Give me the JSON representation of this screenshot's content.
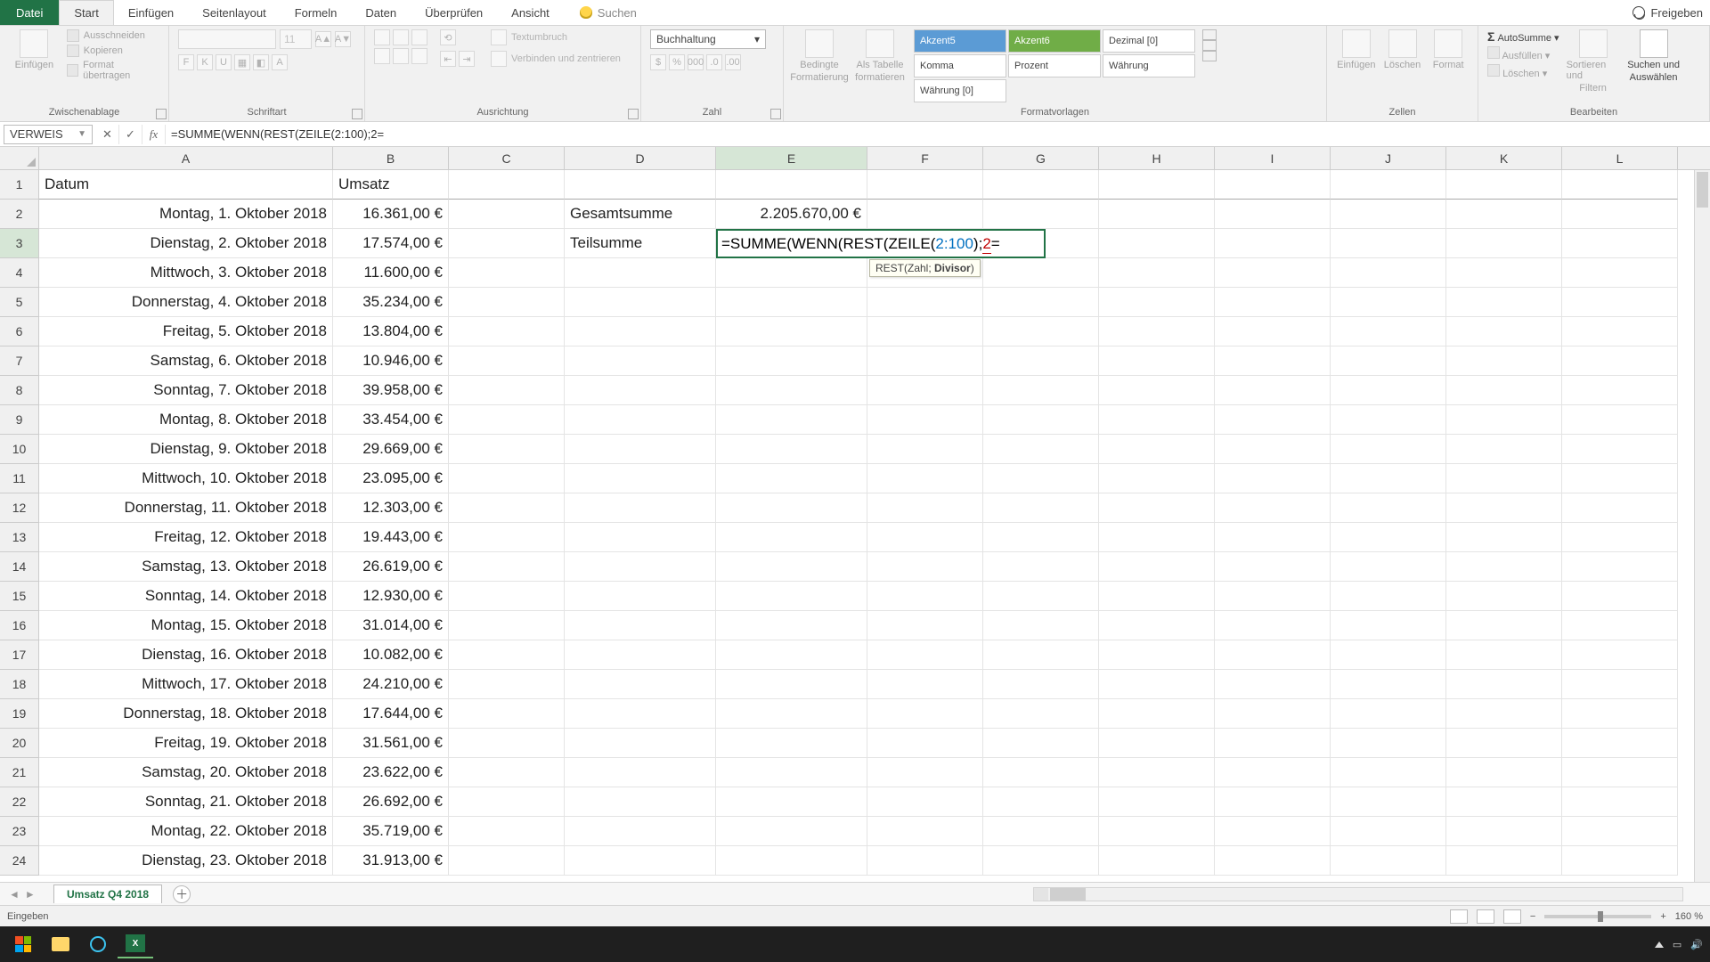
{
  "tabs": {
    "file": "Datei",
    "start": "Start",
    "insert": "Einfügen",
    "pagelayout": "Seitenlayout",
    "formulas": "Formeln",
    "data": "Daten",
    "review": "Überprüfen",
    "view": "Ansicht",
    "tellme": "Suchen",
    "share": "Freigeben"
  },
  "ribbon": {
    "clipboard": {
      "label": "Zwischenablage",
      "paste": "Einfügen",
      "cut": "Ausschneiden",
      "copy": "Kopieren",
      "painter": "Format übertragen"
    },
    "font": {
      "label": "Schriftart",
      "size": "11",
      "boldB": "F",
      "italicK": "K",
      "underlineU": "U"
    },
    "alignment": {
      "label": "Ausrichtung",
      "wrap": "Textumbruch",
      "merge": "Verbinden und zentrieren"
    },
    "number": {
      "label": "Zahl",
      "format": "Buchhaltung"
    },
    "styles": {
      "label": "Formatvorlagen",
      "cond": "Bedingte",
      "cond2": "Formatierung",
      "astable": "Als Tabelle",
      "astable2": "formatieren",
      "g": [
        "Akzent5",
        "Akzent6",
        "Dezimal [0]",
        "Komma",
        "Prozent",
        "Währung",
        "Währung [0]"
      ]
    },
    "cells": {
      "label": "Zellen",
      "insert": "Einfügen",
      "delete": "Löschen",
      "format": "Format"
    },
    "editing": {
      "label": "Bearbeiten",
      "sum": "AutoSumme",
      "fill": "Ausfüllen",
      "clear": "Löschen",
      "sort": "Sortieren und",
      "sort2": "Filtern",
      "find": "Suchen und",
      "find2": "Auswählen"
    }
  },
  "fbar": {
    "name": "VERWEIS",
    "formula": "=SUMME(WENN(REST(ZEILE(2:100);2="
  },
  "columns": [
    "A",
    "B",
    "C",
    "D",
    "E",
    "F",
    "G",
    "H",
    "I",
    "J",
    "K",
    "L"
  ],
  "headers": {
    "A": "Datum",
    "B": "Umsatz",
    "D2": "Gesamtsumme",
    "D3": "Teilsumme",
    "E2": "2.205.670,00 €"
  },
  "editing": {
    "pre": "=SUMME(WENN(",
    "rest": "REST(ZEILE(",
    "range": "2:100",
    "mid": ");",
    "div": "2",
    "post": "=",
    "tooltip_pre": "REST(Zahl; ",
    "tooltip_bold": "Divisor",
    "tooltip_post": ")"
  },
  "rows": [
    {
      "n": 1
    },
    {
      "n": 2,
      "A": "Montag, 1. Oktober 2018",
      "B": "16.361,00 €"
    },
    {
      "n": 3,
      "A": "Dienstag, 2. Oktober 2018",
      "B": "17.574,00 €"
    },
    {
      "n": 4,
      "A": "Mittwoch, 3. Oktober 2018",
      "B": "11.600,00 €"
    },
    {
      "n": 5,
      "A": "Donnerstag, 4. Oktober 2018",
      "B": "35.234,00 €"
    },
    {
      "n": 6,
      "A": "Freitag, 5. Oktober 2018",
      "B": "13.804,00 €"
    },
    {
      "n": 7,
      "A": "Samstag, 6. Oktober 2018",
      "B": "10.946,00 €"
    },
    {
      "n": 8,
      "A": "Sonntag, 7. Oktober 2018",
      "B": "39.958,00 €"
    },
    {
      "n": 9,
      "A": "Montag, 8. Oktober 2018",
      "B": "33.454,00 €"
    },
    {
      "n": 10,
      "A": "Dienstag, 9. Oktober 2018",
      "B": "29.669,00 €"
    },
    {
      "n": 11,
      "A": "Mittwoch, 10. Oktober 2018",
      "B": "23.095,00 €"
    },
    {
      "n": 12,
      "A": "Donnerstag, 11. Oktober 2018",
      "B": "12.303,00 €"
    },
    {
      "n": 13,
      "A": "Freitag, 12. Oktober 2018",
      "B": "19.443,00 €"
    },
    {
      "n": 14,
      "A": "Samstag, 13. Oktober 2018",
      "B": "26.619,00 €"
    },
    {
      "n": 15,
      "A": "Sonntag, 14. Oktober 2018",
      "B": "12.930,00 €"
    },
    {
      "n": 16,
      "A": "Montag, 15. Oktober 2018",
      "B": "31.014,00 €"
    },
    {
      "n": 17,
      "A": "Dienstag, 16. Oktober 2018",
      "B": "10.082,00 €"
    },
    {
      "n": 18,
      "A": "Mittwoch, 17. Oktober 2018",
      "B": "24.210,00 €"
    },
    {
      "n": 19,
      "A": "Donnerstag, 18. Oktober 2018",
      "B": "17.644,00 €"
    },
    {
      "n": 20,
      "A": "Freitag, 19. Oktober 2018",
      "B": "31.561,00 €"
    },
    {
      "n": 21,
      "A": "Samstag, 20. Oktober 2018",
      "B": "23.622,00 €"
    },
    {
      "n": 22,
      "A": "Sonntag, 21. Oktober 2018",
      "B": "26.692,00 €"
    },
    {
      "n": 23,
      "A": "Montag, 22. Oktober 2018",
      "B": "35.719,00 €"
    },
    {
      "n": 24,
      "A": "Dienstag, 23. Oktober 2018",
      "B": "31.913,00 €"
    }
  ],
  "sheet": {
    "name": "Umsatz Q4 2018"
  },
  "status": {
    "mode": "Eingeben",
    "zoom": "160 %"
  }
}
